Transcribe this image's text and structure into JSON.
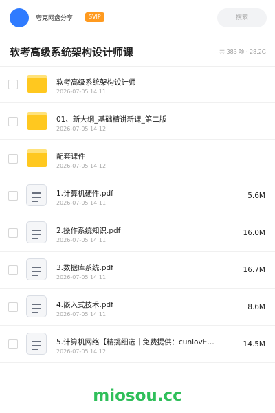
{
  "header": {
    "share_name": "夸克网盘分享",
    "vip_label": "SVIP",
    "search_placeholder": "搜索",
    "colors": {
      "avatar": "#2f7bff",
      "vip": "#ff9a1f"
    }
  },
  "folder": {
    "title": "软考高级系统架构设计师课",
    "meta": "共 383 项 · 28.2G"
  },
  "files": [
    {
      "name": "软考高级系统架构设计师",
      "date": "2026-07-05 14:11",
      "size": "",
      "type": "folder"
    },
    {
      "name": "01、新大纲_基础精讲新课_第二版",
      "date": "2026-07-05 14:12",
      "size": "",
      "type": "folder"
    },
    {
      "name": "配套课件",
      "date": "2026-07-05 14:12",
      "size": "",
      "type": "folder"
    },
    {
      "name": "1.计算机硬件.pdf",
      "date": "2026-07-05 14:11",
      "size": "5.6M",
      "type": "document"
    },
    {
      "name": "2.操作系统知识.pdf",
      "date": "2026-07-05 14:11",
      "size": "16.0M",
      "type": "document"
    },
    {
      "name": "3.数据库系统.pdf",
      "date": "2026-07-05 14:11",
      "size": "16.7M",
      "type": "document"
    },
    {
      "name": "4.嵌入式技术.pdf",
      "date": "2026-07-05 14:11",
      "size": "8.6M",
      "type": "document"
    },
    {
      "name": "5.计算机网络【精挑细选｜免费提供：cunlovE…",
      "date": "2026-07-05 14:12",
      "size": "14.5M",
      "type": "document"
    }
  ],
  "footer": {
    "brand": "miosou.cc",
    "brand_color": "#2fbf5a"
  }
}
